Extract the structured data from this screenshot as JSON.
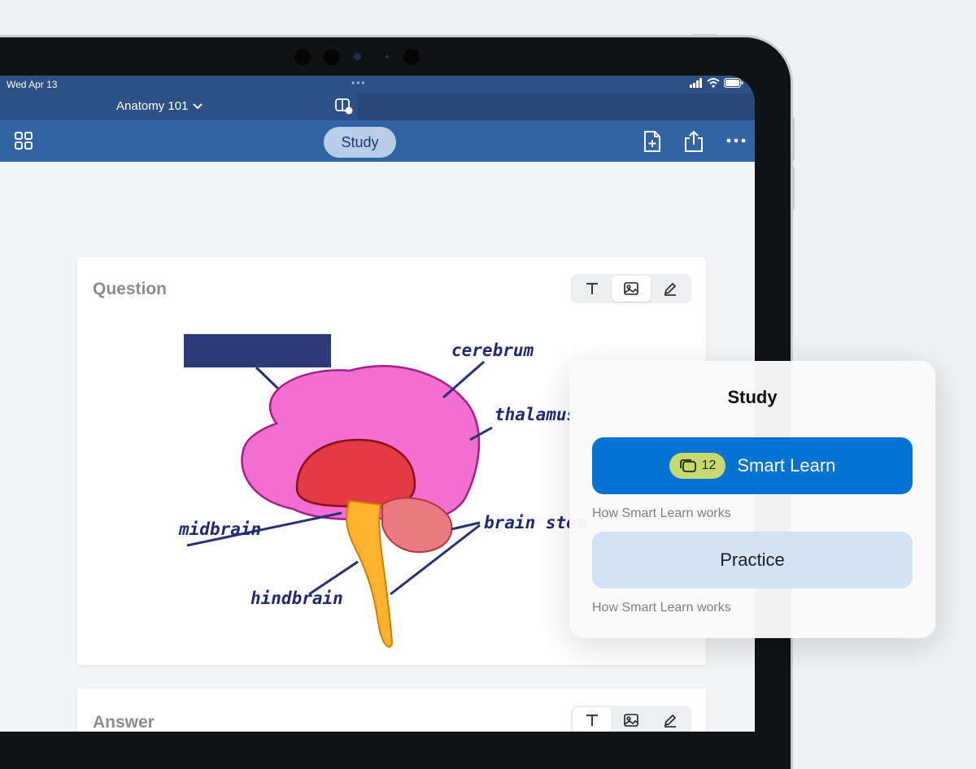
{
  "status": {
    "date": "Wed Apr 13"
  },
  "header": {
    "deck_title": "Anatomy 101",
    "mode_label": "Study"
  },
  "question": {
    "label": "Question",
    "diagram_labels": {
      "cerebrum": "cerebrum",
      "thalamus": "thalamus",
      "midbrain": "midbrain",
      "brain_stem": "brain stem",
      "hindbrain": "hindbrain"
    }
  },
  "answer": {
    "label": "Answer"
  },
  "study_popover": {
    "title": "Study",
    "smart_learn_label": "Smart Learn",
    "card_count": "12",
    "helper_1": "How Smart Learn works",
    "practice_label": "Practice",
    "helper_2": "How Smart Learn works"
  },
  "colors": {
    "nav": "#3263a5",
    "primary": "#0573d2",
    "practice": "#d3e3f3",
    "badge": "#c8d96f"
  },
  "icons": [
    "grid-icon",
    "add-page-icon",
    "share-icon",
    "more-icon",
    "text-icon",
    "image-icon",
    "draw-icon",
    "chevron-down-icon",
    "split-view-icon",
    "cards-icon",
    "wifi-icon",
    "signal-icon",
    "battery-icon"
  ]
}
